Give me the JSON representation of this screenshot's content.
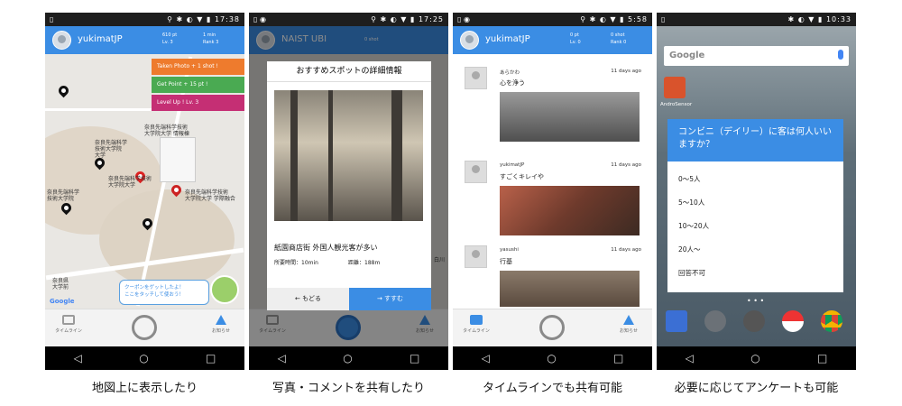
{
  "captions": [
    "地図上に表示したり",
    "写真・コメントを共有したり",
    "タイムラインでも共有可能",
    "必要に応じてアンケートも可能"
  ],
  "status": {
    "p1": "17:38",
    "p2": "17:25",
    "p3": "5:58",
    "p4": "10:33"
  },
  "nav": {
    "back": "◁",
    "home": "○",
    "recent": "□"
  },
  "app": {
    "user1": "yukimatJP",
    "user2": "NAIST UBI",
    "stats1": {
      "shot": "610 pt",
      "time": "1 min",
      "lv": "Lv. 3",
      "rank": "Rank 3"
    },
    "stats2": {
      "shot": "0 shot"
    },
    "stats3": {
      "shot": "0 pt",
      "time": "0 shot",
      "lv": "Lv. 0",
      "rank": "Rank 0"
    },
    "bottom": {
      "timeline": "タイムライン",
      "notify": "お知らせ"
    }
  },
  "map": {
    "banners": [
      "Taken Photo + 1 shot !",
      "Get Point + 15 pt !",
      "Level Up !   Lv. 3"
    ],
    "banner_colors": [
      "#ee7b2d",
      "#4aaa52",
      "#c52f74"
    ],
    "labels": [
      "奈良先端科学技術\n大学院大学 情報棟",
      "奈良先端科学\n技術大学院\n大学",
      "奈良先端科学\n技術大学院",
      "奈良先端科学技術\n大学院大学 学際融合",
      "奈良先端科学技術\n大学院大学",
      "奈良県\n大学前",
      "白川"
    ],
    "coupon": "クーポンをゲットしたよ！\nここをタッチして使おう！",
    "google": "Google"
  },
  "detail": {
    "title": "おすすめスポットの詳細情報",
    "desc": "紙園商店街 外国人観光客が多い",
    "time": "所要時間：10min",
    "distance": "距離：188m",
    "back": "もどる",
    "next": "すすむ"
  },
  "timeline": [
    {
      "user": "あらかわ",
      "age": "11 days ago",
      "comment": "心を浄う"
    },
    {
      "user": "yukimatJP",
      "age": "11 days ago",
      "comment": "すごくキレイや"
    },
    {
      "user": "yasushi",
      "age": "11 days ago",
      "comment": "行基"
    }
  ],
  "android": {
    "google": "Google",
    "app_label": "AndroSensor",
    "question": "コンビニ（デイリー）に客は何人いいますか？",
    "options": [
      "0〜5人",
      "5〜10人",
      "10〜20人",
      "20人〜",
      "回答不可"
    ]
  }
}
